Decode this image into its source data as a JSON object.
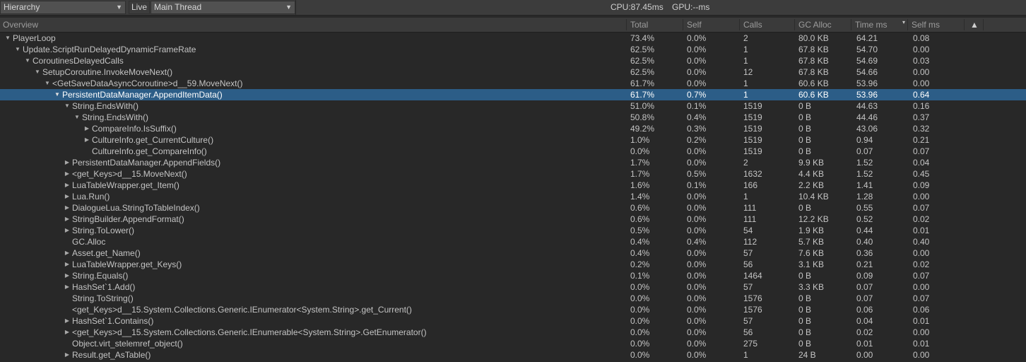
{
  "toolbar": {
    "view_dropdown": "Hierarchy",
    "live_label": "Live",
    "thread_dropdown": "Main Thread",
    "cpu_label": "CPU:87.45ms",
    "gpu_label": "GPU:--ms"
  },
  "columns": {
    "overview": "Overview",
    "total": "Total",
    "self": "Self",
    "calls": "Calls",
    "gc_alloc": "GC Alloc",
    "time_ms": "Time ms",
    "self_ms": "Self ms",
    "sort_indicator": "▾",
    "column_toggle": "▲"
  },
  "rows": [
    {
      "name": "PlayerLoop",
      "depth": 0,
      "expander": "expanded",
      "total": "73.4%",
      "self": "0.0%",
      "calls": "2",
      "gc": "80.0 KB",
      "time": "64.21",
      "selfms": "0.08",
      "selected": false
    },
    {
      "name": "Update.ScriptRunDelayedDynamicFrameRate",
      "depth": 1,
      "expander": "expanded",
      "total": "62.5%",
      "self": "0.0%",
      "calls": "1",
      "gc": "67.8 KB",
      "time": "54.70",
      "selfms": "0.00",
      "selected": false
    },
    {
      "name": "CoroutinesDelayedCalls",
      "depth": 2,
      "expander": "expanded",
      "total": "62.5%",
      "self": "0.0%",
      "calls": "1",
      "gc": "67.8 KB",
      "time": "54.69",
      "selfms": "0.03",
      "selected": false
    },
    {
      "name": "SetupCoroutine.InvokeMoveNext()",
      "depth": 3,
      "expander": "expanded",
      "total": "62.5%",
      "self": "0.0%",
      "calls": "12",
      "gc": "67.8 KB",
      "time": "54.66",
      "selfms": "0.00",
      "selected": false
    },
    {
      "name": "<GetSaveDataAsyncCoroutine>d__59.MoveNext()",
      "depth": 4,
      "expander": "expanded",
      "total": "61.7%",
      "self": "0.0%",
      "calls": "1",
      "gc": "60.6 KB",
      "time": "53.96",
      "selfms": "0.00",
      "selected": false
    },
    {
      "name": "PersistentDataManager.AppendItemData()",
      "depth": 5,
      "expander": "expanded",
      "total": "61.7%",
      "self": "0.7%",
      "calls": "1",
      "gc": "60.6 KB",
      "time": "53.96",
      "selfms": "0.64",
      "selected": true
    },
    {
      "name": "String.EndsWith()",
      "depth": 6,
      "expander": "expanded",
      "total": "51.0%",
      "self": "0.1%",
      "calls": "1519",
      "gc": "0 B",
      "time": "44.63",
      "selfms": "0.16",
      "selected": false
    },
    {
      "name": "String.EndsWith()",
      "depth": 7,
      "expander": "expanded",
      "total": "50.8%",
      "self": "0.4%",
      "calls": "1519",
      "gc": "0 B",
      "time": "44.46",
      "selfms": "0.37",
      "selected": false
    },
    {
      "name": "CompareInfo.IsSuffix()",
      "depth": 8,
      "expander": "collapsed",
      "total": "49.2%",
      "self": "0.3%",
      "calls": "1519",
      "gc": "0 B",
      "time": "43.06",
      "selfms": "0.32",
      "selected": false
    },
    {
      "name": "CultureInfo.get_CurrentCulture()",
      "depth": 8,
      "expander": "collapsed",
      "total": "1.0%",
      "self": "0.2%",
      "calls": "1519",
      "gc": "0 B",
      "time": "0.94",
      "selfms": "0.21",
      "selected": false
    },
    {
      "name": "CultureInfo.get_CompareInfo()",
      "depth": 8,
      "expander": "none",
      "total": "0.0%",
      "self": "0.0%",
      "calls": "1519",
      "gc": "0 B",
      "time": "0.07",
      "selfms": "0.07",
      "selected": false
    },
    {
      "name": "PersistentDataManager.AppendFields()",
      "depth": 6,
      "expander": "collapsed",
      "total": "1.7%",
      "self": "0.0%",
      "calls": "2",
      "gc": "9.9 KB",
      "time": "1.52",
      "selfms": "0.04",
      "selected": false
    },
    {
      "name": "<get_Keys>d__15.MoveNext()",
      "depth": 6,
      "expander": "collapsed",
      "total": "1.7%",
      "self": "0.5%",
      "calls": "1632",
      "gc": "4.4 KB",
      "time": "1.52",
      "selfms": "0.45",
      "selected": false
    },
    {
      "name": "LuaTableWrapper.get_Item()",
      "depth": 6,
      "expander": "collapsed",
      "total": "1.6%",
      "self": "0.1%",
      "calls": "166",
      "gc": "2.2 KB",
      "time": "1.41",
      "selfms": "0.09",
      "selected": false
    },
    {
      "name": "Lua.Run()",
      "depth": 6,
      "expander": "collapsed",
      "total": "1.4%",
      "self": "0.0%",
      "calls": "1",
      "gc": "10.4 KB",
      "time": "1.28",
      "selfms": "0.00",
      "selected": false
    },
    {
      "name": "DialogueLua.StringToTableIndex()",
      "depth": 6,
      "expander": "collapsed",
      "total": "0.6%",
      "self": "0.0%",
      "calls": "111",
      "gc": "0 B",
      "time": "0.55",
      "selfms": "0.07",
      "selected": false
    },
    {
      "name": "StringBuilder.AppendFormat()",
      "depth": 6,
      "expander": "collapsed",
      "total": "0.6%",
      "self": "0.0%",
      "calls": "111",
      "gc": "12.2 KB",
      "time": "0.52",
      "selfms": "0.02",
      "selected": false
    },
    {
      "name": "String.ToLower()",
      "depth": 6,
      "expander": "collapsed",
      "total": "0.5%",
      "self": "0.0%",
      "calls": "54",
      "gc": "1.9 KB",
      "time": "0.44",
      "selfms": "0.01",
      "selected": false
    },
    {
      "name": "GC.Alloc",
      "depth": 6,
      "expander": "none",
      "total": "0.4%",
      "self": "0.4%",
      "calls": "112",
      "gc": "5.7 KB",
      "time": "0.40",
      "selfms": "0.40",
      "selected": false
    },
    {
      "name": "Asset.get_Name()",
      "depth": 6,
      "expander": "collapsed",
      "total": "0.4%",
      "self": "0.0%",
      "calls": "57",
      "gc": "7.6 KB",
      "time": "0.36",
      "selfms": "0.00",
      "selected": false
    },
    {
      "name": "LuaTableWrapper.get_Keys()",
      "depth": 6,
      "expander": "collapsed",
      "total": "0.2%",
      "self": "0.0%",
      "calls": "56",
      "gc": "3.1 KB",
      "time": "0.21",
      "selfms": "0.02",
      "selected": false
    },
    {
      "name": "String.Equals()",
      "depth": 6,
      "expander": "collapsed",
      "total": "0.1%",
      "self": "0.0%",
      "calls": "1464",
      "gc": "0 B",
      "time": "0.09",
      "selfms": "0.07",
      "selected": false
    },
    {
      "name": "HashSet`1.Add()",
      "depth": 6,
      "expander": "collapsed",
      "total": "0.0%",
      "self": "0.0%",
      "calls": "57",
      "gc": "3.3 KB",
      "time": "0.07",
      "selfms": "0.00",
      "selected": false
    },
    {
      "name": "String.ToString()",
      "depth": 6,
      "expander": "none",
      "total": "0.0%",
      "self": "0.0%",
      "calls": "1576",
      "gc": "0 B",
      "time": "0.07",
      "selfms": "0.07",
      "selected": false
    },
    {
      "name": "<get_Keys>d__15.System.Collections.Generic.IEnumerator<System.String>.get_Current()",
      "depth": 6,
      "expander": "none",
      "total": "0.0%",
      "self": "0.0%",
      "calls": "1576",
      "gc": "0 B",
      "time": "0.06",
      "selfms": "0.06",
      "selected": false
    },
    {
      "name": "HashSet`1.Contains()",
      "depth": 6,
      "expander": "collapsed",
      "total": "0.0%",
      "self": "0.0%",
      "calls": "57",
      "gc": "0 B",
      "time": "0.04",
      "selfms": "0.01",
      "selected": false
    },
    {
      "name": "<get_Keys>d__15.System.Collections.Generic.IEnumerable<System.String>.GetEnumerator()",
      "depth": 6,
      "expander": "collapsed",
      "total": "0.0%",
      "self": "0.0%",
      "calls": "56",
      "gc": "0 B",
      "time": "0.02",
      "selfms": "0.00",
      "selected": false
    },
    {
      "name": "Object.virt_stelemref_object()",
      "depth": 6,
      "expander": "none",
      "total": "0.0%",
      "self": "0.0%",
      "calls": "275",
      "gc": "0 B",
      "time": "0.01",
      "selfms": "0.01",
      "selected": false
    },
    {
      "name": "Result.get_AsTable()",
      "depth": 6,
      "expander": "collapsed",
      "total": "0.0%",
      "self": "0.0%",
      "calls": "1",
      "gc": "24 B",
      "time": "0.00",
      "selfms": "0.00",
      "selected": false
    }
  ]
}
